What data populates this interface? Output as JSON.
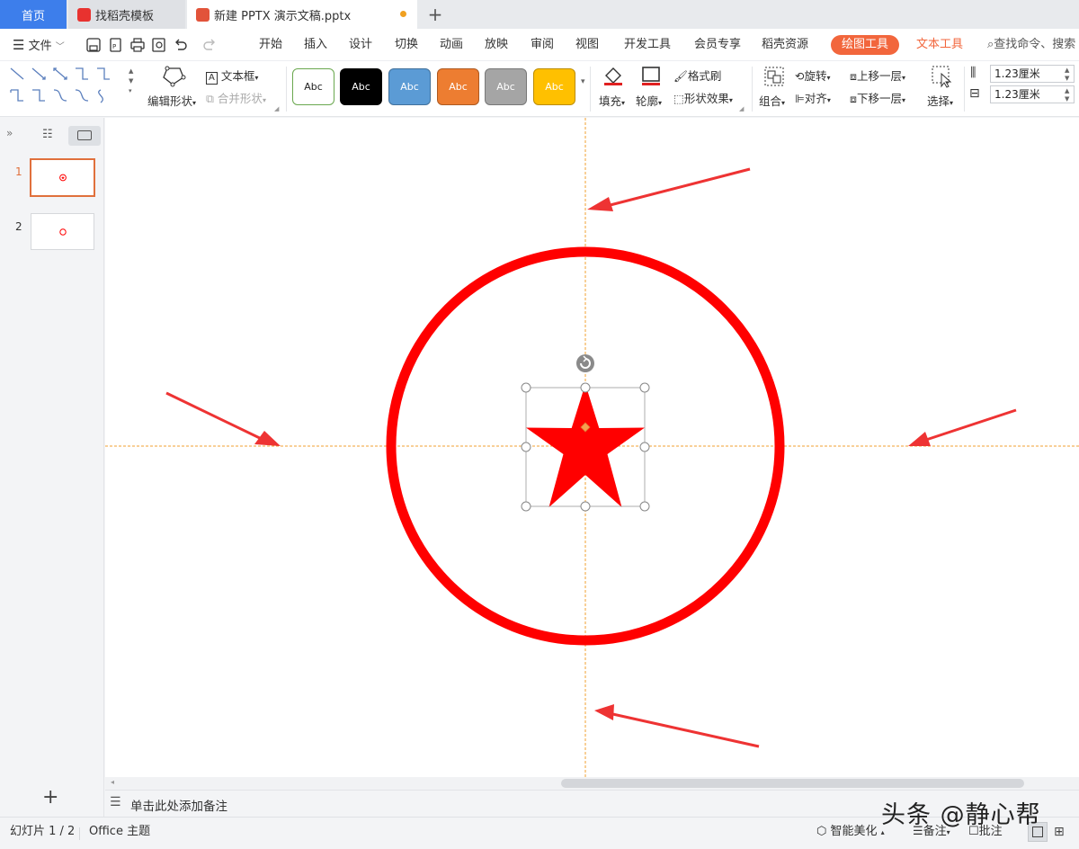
{
  "tabs": {
    "home": "首页",
    "template": "找稻壳模板",
    "document": "新建 PPTX 演示文稿.pptx"
  },
  "menu": {
    "file": "文件",
    "items": [
      "开始",
      "插入",
      "设计",
      "切换",
      "动画",
      "放映",
      "审阅",
      "视图",
      "开发工具",
      "会员专享",
      "稻壳资源"
    ],
    "drawing_tools": "绘图工具",
    "text_tools": "文本工具",
    "search": "查找命令、搜索"
  },
  "ribbon": {
    "edit_shape": "编辑形状",
    "text_box": "文本框",
    "merge_shape": "合并形状",
    "swatch_label": "Abc",
    "fill": "填充",
    "outline": "轮廓",
    "format_painter": "格式刷",
    "shape_effects": "形状效果",
    "group": "组合",
    "rotate": "旋转",
    "align": "对齐",
    "bring_forward": "上移一层",
    "send_backward": "下移一层",
    "select": "选择",
    "height": "1.23厘米",
    "width": "1.23厘米"
  },
  "colors": {
    "accent": "#f2663c",
    "tab_home": "#3d7eeb",
    "shape_red": "#ff0000",
    "arrow_red": "#ee3333",
    "guide_orange": "#f0a030"
  },
  "slides": {
    "items": [
      {
        "number": "1",
        "selected": true
      },
      {
        "number": "2",
        "selected": false
      }
    ]
  },
  "notes": {
    "placeholder": "单击此处添加备注"
  },
  "status": {
    "slide_counter": "幻灯片 1 / 2",
    "theme": "Office 主题",
    "smart_beautify": "智能美化",
    "notes": "备注",
    "comments": "批注"
  },
  "watermark": "头条 @静心帮"
}
